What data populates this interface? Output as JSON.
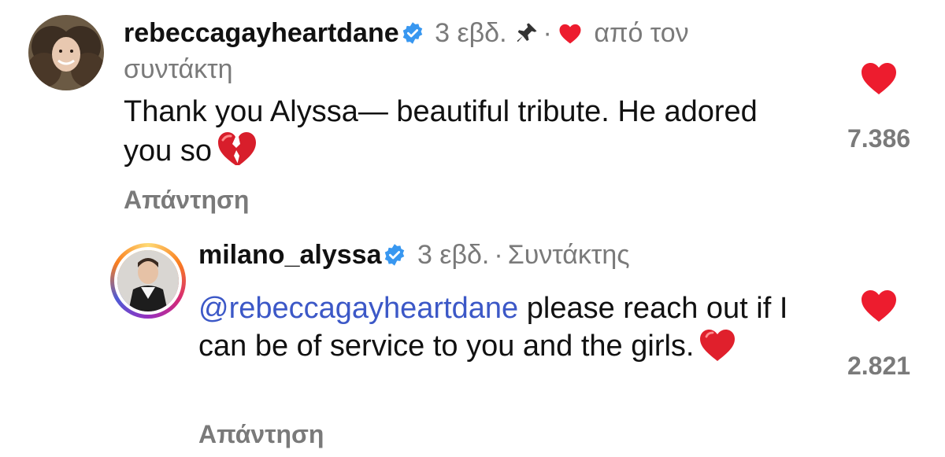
{
  "comments": [
    {
      "username": "rebeccagayheartdane",
      "time": "3 εβδ.",
      "author_tag_line1": "από τον",
      "author_tag_line2": "συντάκτη",
      "body": "Thank you Alyssa— beautiful tribute. He adored you so",
      "body_emoji": "broken-heart",
      "reply_label": "Απάντηση",
      "like_count": "7.386"
    },
    {
      "username": "milano_alyssa",
      "time": "3 εβδ.",
      "role": "Συντάκτης",
      "mention": "@rebeccagayheartdane",
      "body": " please reach out if I can be of service to you and the girls.",
      "body_emoji": "red-heart",
      "reply_label": "Απάντηση",
      "like_count": "2.821"
    }
  ],
  "colors": {
    "heart": "#ed1c2e",
    "verified": "#3897f0",
    "mention": "#3c58c7",
    "meta_text": "#7a7a7a"
  }
}
